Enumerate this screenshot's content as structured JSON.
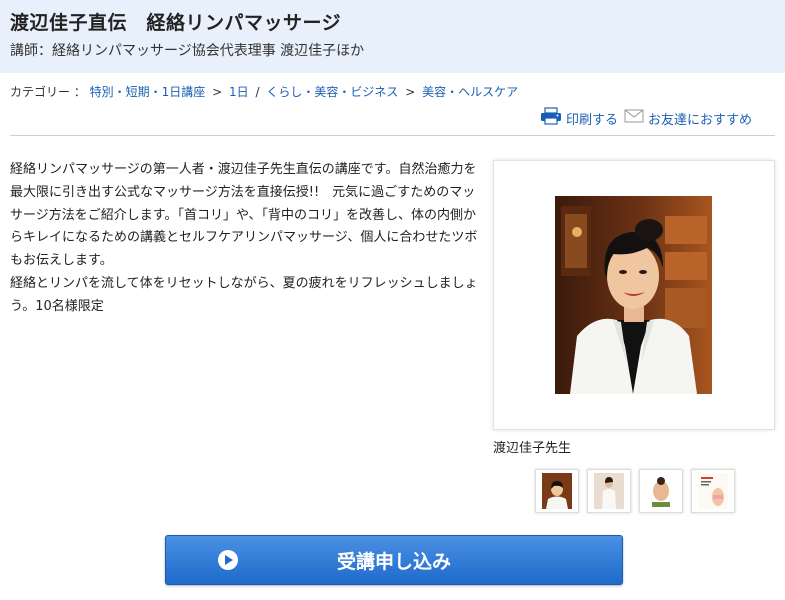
{
  "header": {
    "title": "渡辺佳子直伝　経絡リンパマッサージ",
    "lecturer": "講師：経絡リンパマッサージ協会代表理事 渡辺佳子ほか"
  },
  "breadcrumb": {
    "label": "カテゴリー ：",
    "items": [
      "特別・短期・1日講座",
      "1日",
      "くらし・美容・ビジネス",
      "美容・ヘルスケア"
    ],
    "separators": [
      ">",
      "/",
      ">"
    ]
  },
  "actions": {
    "print": {
      "label": "印刷する",
      "icon": "printer-icon"
    },
    "share": {
      "label": "お友達におすすめ",
      "icon": "mail-icon"
    }
  },
  "description": {
    "paragraph1": "経絡リンパマッサージの第一人者・渡辺佳子先生直伝の講座です。自然治癒力を最大限に引き出す公式なマッサージ方法を直接伝授!!　元気に過ごすためのマッサージ方法をご紹介します。「首コリ」や、「背中のコリ」を改善し、体の内側からキレイになるための講義とセルフケアリンパマッサージ、個人に合わせたツボもお伝えします。",
    "paragraph2": "経絡とリンパを流して体をリセットしながら、夏の疲れをリフレッシュしましょう。10名様限定"
  },
  "photo": {
    "caption": "渡辺佳子先生"
  },
  "thumbnails": [
    "thumbnail-instructor-portrait",
    "thumbnail-instructor-full",
    "thumbnail-massage",
    "thumbnail-book"
  ],
  "apply_button": {
    "label": "受講申し込み",
    "icon": "play-icon"
  },
  "colors": {
    "header_bg": "#e8f0fb",
    "link": "#1a5fb4",
    "button": "#1f6bcc"
  }
}
